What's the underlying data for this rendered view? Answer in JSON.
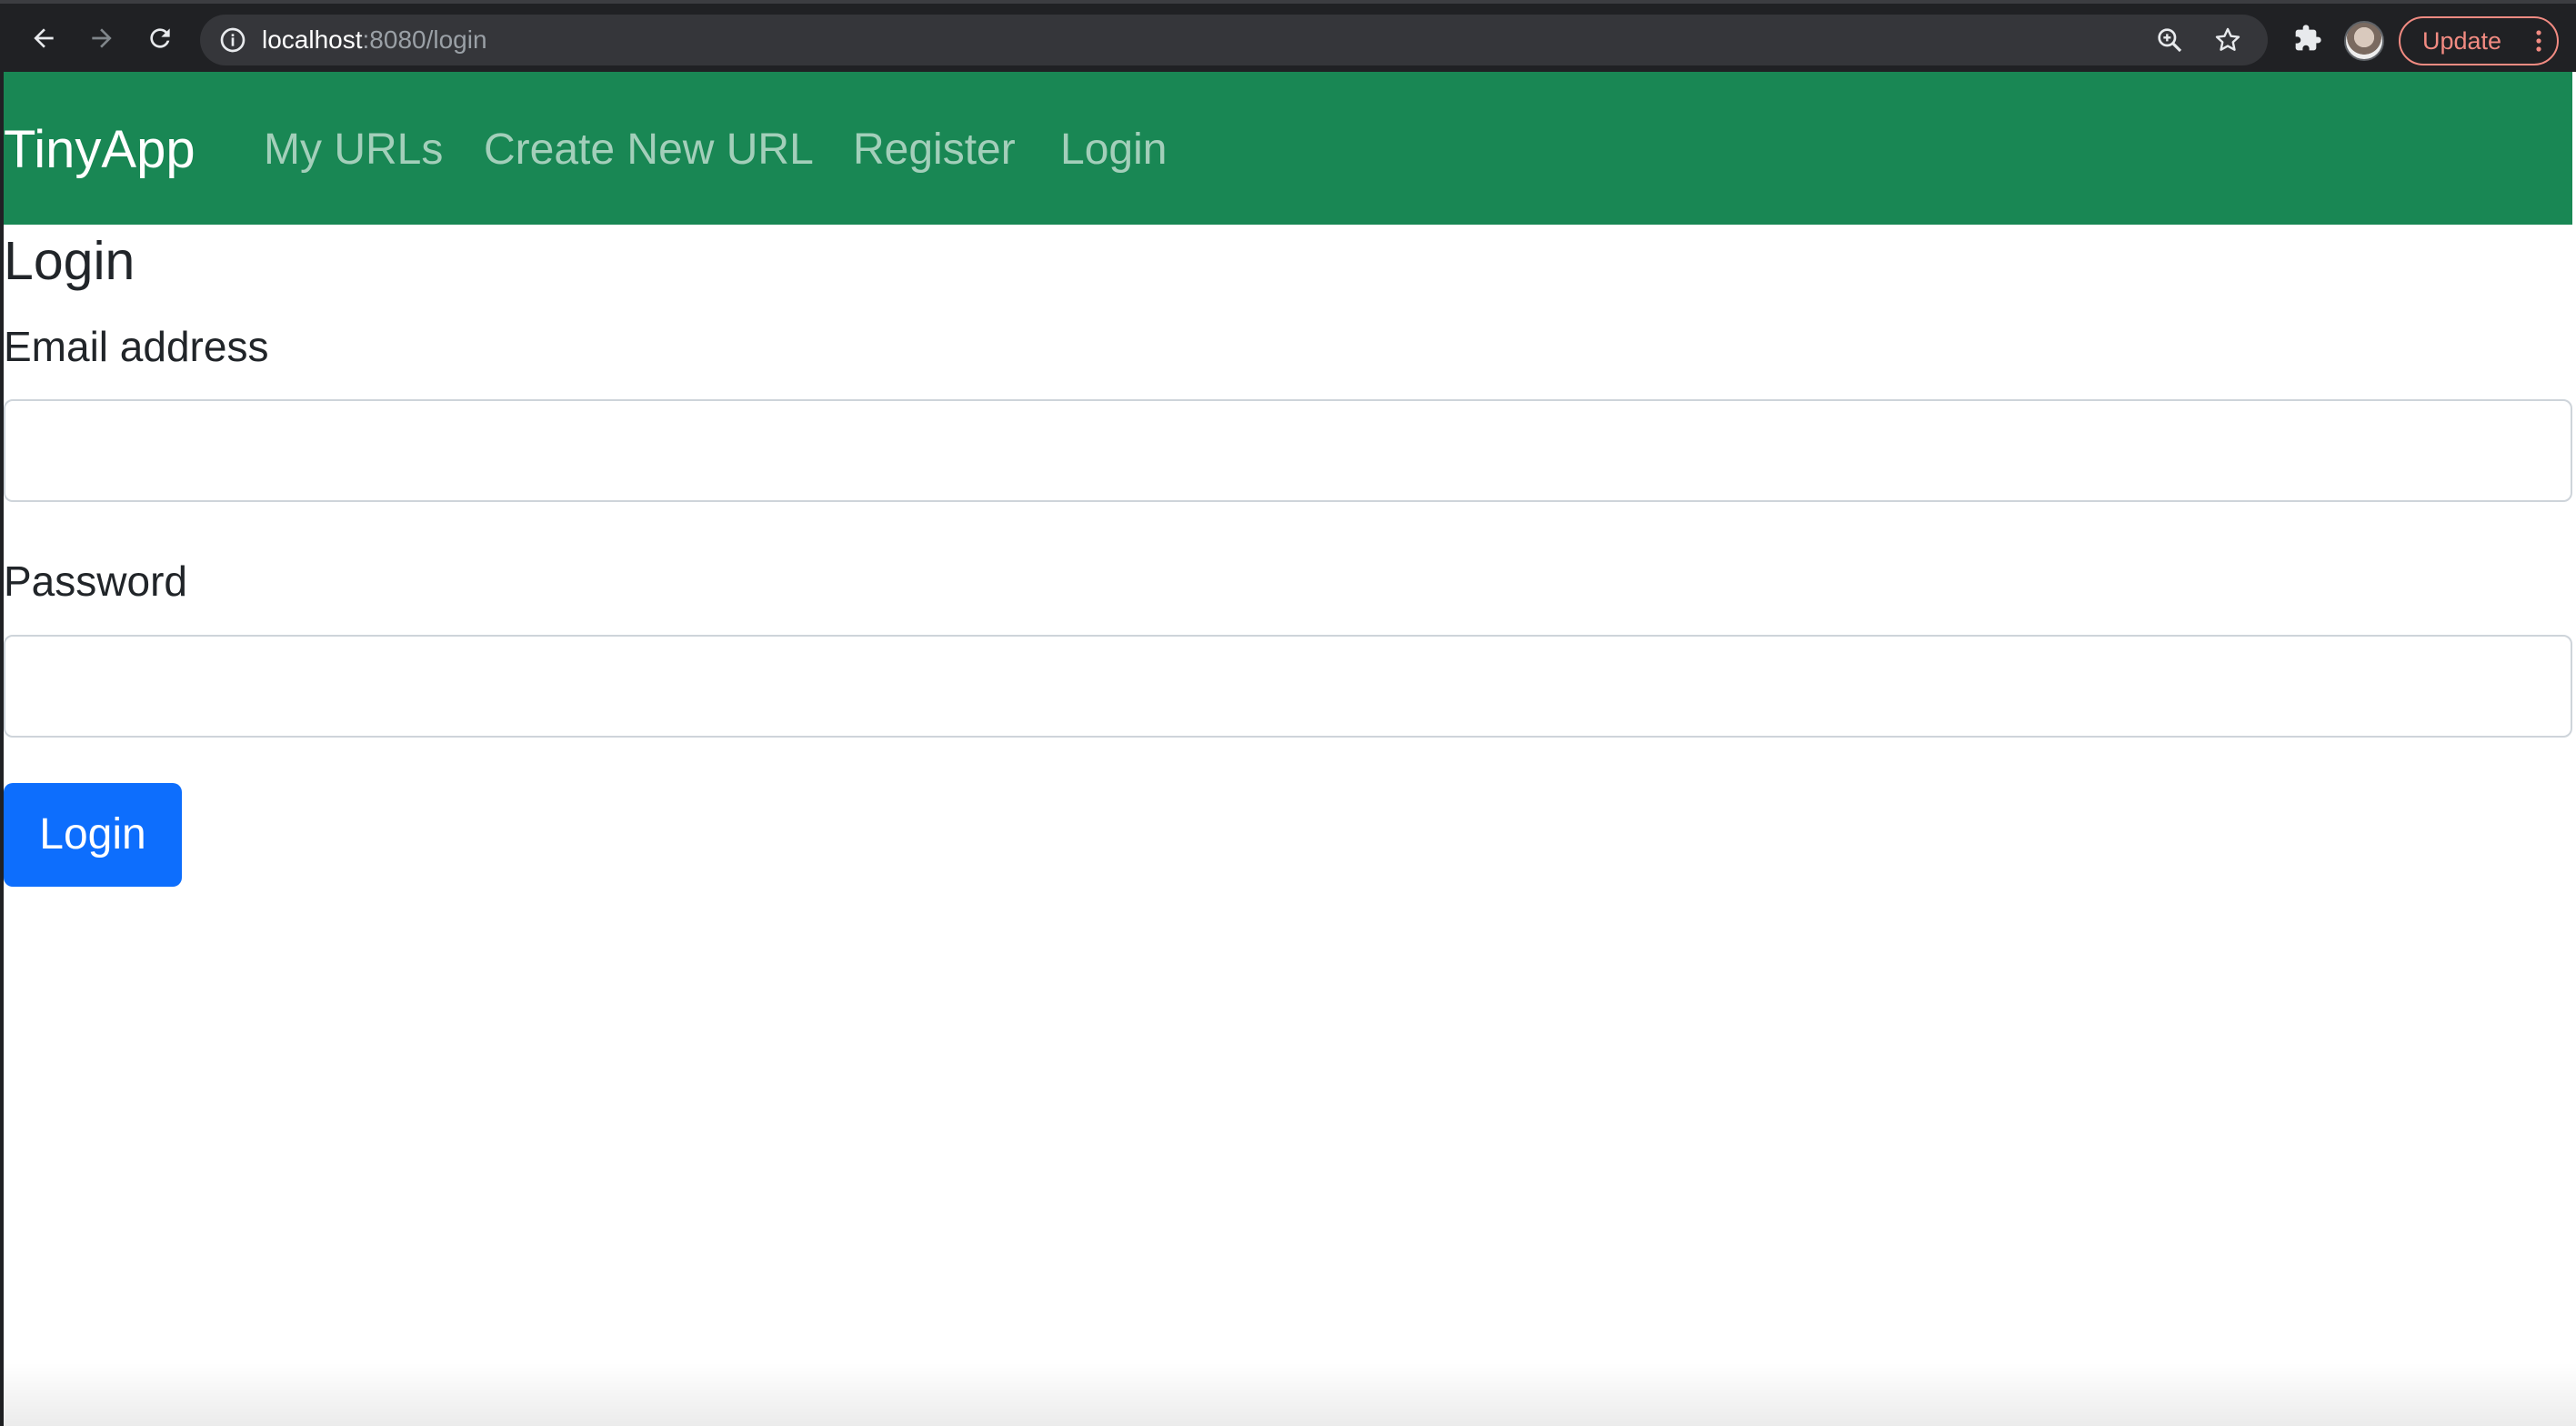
{
  "browser": {
    "url_host": "localhost",
    "url_rest": ":8080/login",
    "update_label": "Update",
    "icons": {
      "back": "arrow-left-icon",
      "forward": "arrow-right-icon",
      "reload": "reload-icon",
      "site_info": "info-icon",
      "zoom": "zoom-icon",
      "bookmark": "star-icon",
      "extensions": "puzzle-icon",
      "menu": "kebab-menu-icon"
    },
    "colors": {
      "chrome_bg": "#202124",
      "update_accent": "#f28b82"
    }
  },
  "navbar": {
    "brand": "TinyApp",
    "links": [
      {
        "label": "My URLs"
      },
      {
        "label": "Create New URL"
      },
      {
        "label": "Register"
      },
      {
        "label": "Login"
      }
    ],
    "color": "#198754"
  },
  "main": {
    "title": "Login",
    "email": {
      "label": "Email address",
      "value": "",
      "placeholder": ""
    },
    "password": {
      "label": "Password",
      "value": "",
      "placeholder": ""
    },
    "submit_label": "Login",
    "submit_color": "#0d6efd"
  }
}
